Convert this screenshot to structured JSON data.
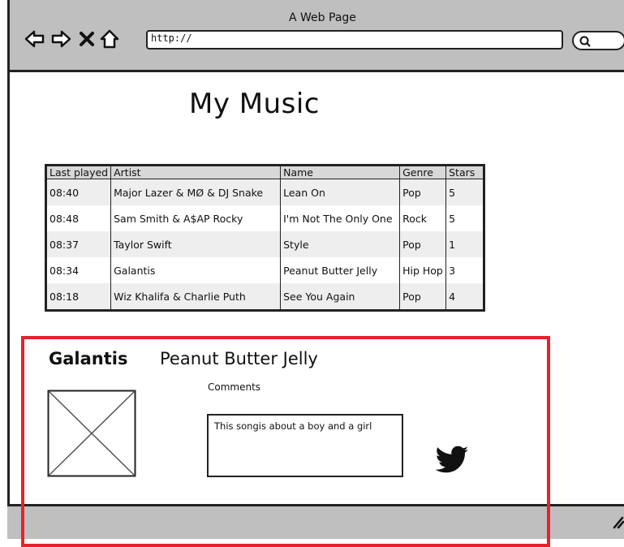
{
  "window": {
    "title": "A Web Page"
  },
  "address_bar": {
    "url": "http://"
  },
  "page": {
    "title": "My Music"
  },
  "table": {
    "headers": [
      "Last played",
      "Artist",
      "Name",
      "Genre",
      "Stars"
    ],
    "rows": [
      {
        "last_played": "08:40",
        "artist": "Major Lazer & MØ & DJ Snake",
        "name": "Lean On",
        "genre": "Pop",
        "stars": "5"
      },
      {
        "last_played": "08:48",
        "artist": "Sam Smith & A$AP Rocky",
        "name": "I'm Not The Only One",
        "genre": "Rock",
        "stars": "5"
      },
      {
        "last_played": "08:37",
        "artist": "Taylor Swift",
        "name": "Style",
        "genre": "Pop",
        "stars": "1"
      },
      {
        "last_played": "08:34",
        "artist": "Galantis",
        "name": "Peanut Butter Jelly",
        "genre": "Hip Hop",
        "stars": "3"
      },
      {
        "last_played": "08:18",
        "artist": "Wiz Khalifa & Charlie Puth",
        "name": "See You Again",
        "genre": "Pop",
        "stars": "4"
      }
    ]
  },
  "detail": {
    "artist": "Galantis",
    "song": "Peanut Butter Jelly",
    "comments_label": "Comments",
    "comment": "This songis about a boy and a girl",
    "share_icon": "twitter-icon",
    "highlight_color": "#e8212c"
  },
  "icons": {
    "back": "back-arrow-icon",
    "forward": "forward-arrow-icon",
    "stop": "close-icon",
    "home": "home-icon",
    "search": "search-icon",
    "image": "image-placeholder-icon",
    "resize": "resize-grip-icon"
  }
}
